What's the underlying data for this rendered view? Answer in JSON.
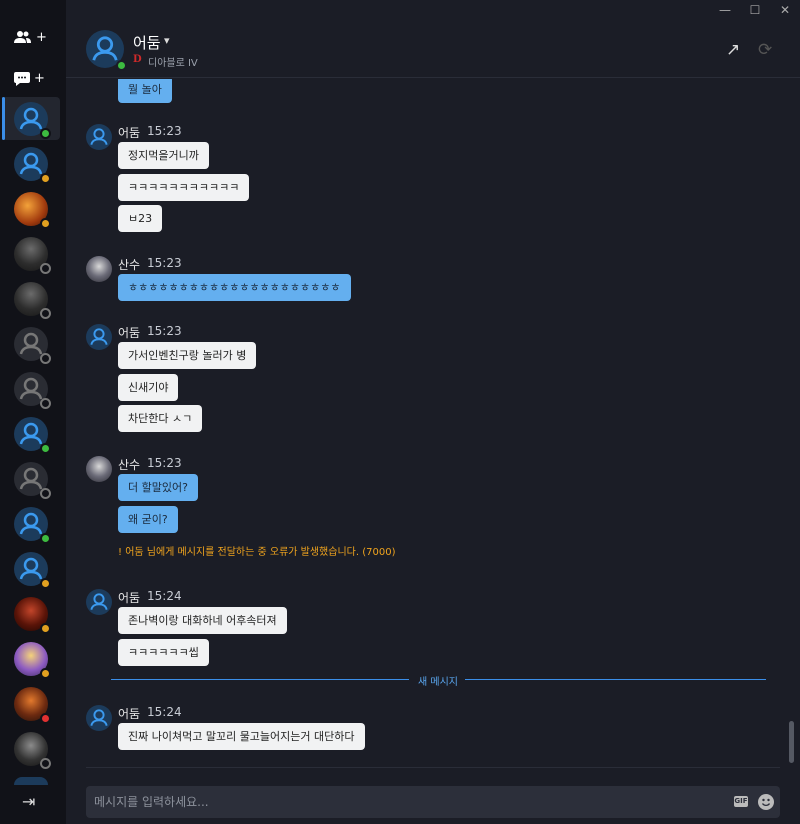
{
  "window": {
    "minimize": "—",
    "maximize": "☐",
    "close": "✕"
  },
  "header": {
    "name": "어둠",
    "game": "디아블로 IV",
    "game_icon": "D"
  },
  "sidebar": {
    "add_friend_plus": "+",
    "new_chat_plus": "+",
    "exit_icon": "⇥"
  },
  "messages": {
    "top_partial_text": "뭘 놀아",
    "g1": {
      "name": "어둠",
      "time": "15:23",
      "lines": [
        "정지먹을거니까",
        "ㅋㅋㅋㅋㅋㅋㅋㅋㅋㅋㅋ",
        "ㅂ23"
      ]
    },
    "g2": {
      "name": "산수",
      "time": "15:23",
      "lines": [
        "ㅎㅎㅎㅎㅎㅎㅎㅎㅎㅎㅎㅎㅎㅎㅎㅎㅎㅎㅎㅎㅎ"
      ]
    },
    "g3": {
      "name": "어둠",
      "time": "15:23",
      "lines": [
        "가서인벤친구랑 놀러가 병",
        "신새기야",
        "차단한다 ㅅㄱ"
      ]
    },
    "g4": {
      "name": "산수",
      "time": "15:23",
      "lines": [
        "더 할말있어?",
        "왜 굳이?"
      ],
      "error": "! 어둠 님에게 메시지를 전달하는 중 오류가 발생했습니다. (7000)"
    },
    "g5": {
      "name": "어둠",
      "time": "15:24",
      "lines": [
        "존나벽이랑 대화하네 어후속터져",
        "ㅋㅋㅋㅋㅋㅋ씹"
      ]
    },
    "new_divider": "새 메시지",
    "g6": {
      "name": "어둠",
      "time": "15:24",
      "lines": [
        "진짜 나이쳐먹고 말꼬리 물고늘어지는거 대단하다"
      ]
    }
  },
  "composer": {
    "placeholder": "메시지를 입력하세요...",
    "gif_label": "GIF"
  },
  "colors": {
    "accent": "#3b8ee8",
    "online": "#3dbb40",
    "away": "#e1a020",
    "error": "#f0a41e",
    "bubble_blue": "#64afef"
  }
}
